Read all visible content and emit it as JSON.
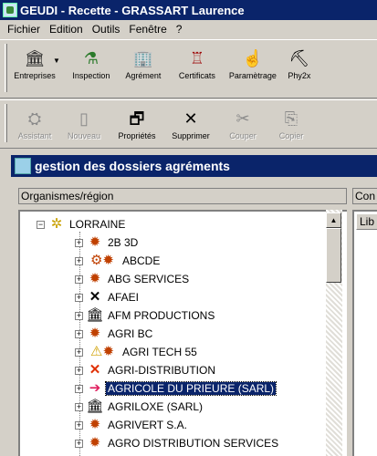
{
  "window": {
    "title": "GEUDI - Recette - GRASSART Laurence"
  },
  "menu": [
    "Fichier",
    "Edition",
    "Outils",
    "Fenêtre",
    "?"
  ],
  "toolbar1": [
    {
      "label": "Entreprises",
      "icon": "building-icon"
    },
    {
      "label": "Inspection",
      "icon": "inspection-icon"
    },
    {
      "label": "Agrément",
      "icon": "agrement-icon"
    },
    {
      "label": "Certificats",
      "icon": "certificate-icon"
    },
    {
      "label": "Paramètrage",
      "icon": "settings-hand-icon"
    },
    {
      "label": "Phy2x",
      "icon": "phy2x-icon"
    }
  ],
  "toolbar2": [
    {
      "label": "Assistant",
      "icon": "wizard-icon",
      "enabled": false
    },
    {
      "label": "Nouveau",
      "icon": "new-document-icon",
      "enabled": false
    },
    {
      "label": "Propriétés",
      "icon": "properties-icon",
      "enabled": true
    },
    {
      "label": "Supprimer",
      "icon": "delete-x-icon",
      "enabled": true
    },
    {
      "label": "Couper",
      "icon": "scissors-icon",
      "enabled": false
    },
    {
      "label": "Copier",
      "icon": "copy-icon",
      "enabled": false
    }
  ],
  "mdi_window": {
    "title": "gestion des dossiers agréments"
  },
  "panel": {
    "header": "Organismes/région",
    "right_header": "Con",
    "right_column": "Lib"
  },
  "tree": {
    "root": {
      "label": "LORRAINE",
      "icon": "region-icon"
    },
    "items": [
      {
        "label": "2B 3D",
        "icon": "gear-icon"
      },
      {
        "label": "ABCDE",
        "icon": "gear-multi-icon"
      },
      {
        "label": "ABG SERVICES",
        "icon": "gear-icon"
      },
      {
        "label": "AFAEI",
        "icon": "cross-icon"
      },
      {
        "label": "AFM PRODUCTIONS",
        "icon": "building-icon"
      },
      {
        "label": "AGRI BC",
        "icon": "gear-icon"
      },
      {
        "label": "AGRI TECH 55",
        "icon": "warning-gear-icon"
      },
      {
        "label": "AGRI-DISTRIBUTION",
        "icon": "red-cross-icon"
      },
      {
        "label": "AGRICOLE DU PRIEURE (SARL)",
        "icon": "arrow-right-icon",
        "selected": true
      },
      {
        "label": "AGRILOXE (SARL)",
        "icon": "building-icon"
      },
      {
        "label": "AGRIVERT S.A.",
        "icon": "gear-icon"
      },
      {
        "label": "AGRO DISTRIBUTION SERVICES",
        "icon": "gear-icon"
      }
    ]
  },
  "colors": {
    "title_bar": "#0a246a",
    "face": "#d4d0c8",
    "selected": "#0a246a"
  }
}
